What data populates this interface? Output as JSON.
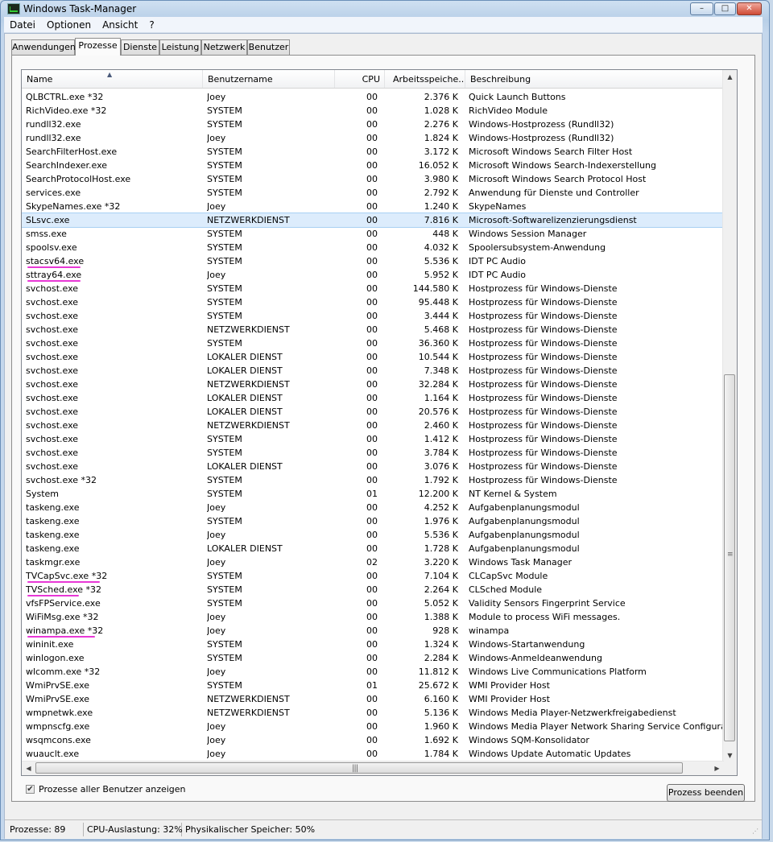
{
  "window": {
    "title": "Windows Task-Manager"
  },
  "menu": [
    "Datei",
    "Optionen",
    "Ansicht",
    "?"
  ],
  "tabs": [
    "Anwendungen",
    "Prozesse",
    "Dienste",
    "Leistung",
    "Netzwerk",
    "Benutzer"
  ],
  "active_tab": "Prozesse",
  "columns": [
    "Name",
    "Benutzername",
    "CPU",
    "Arbeitsspeiche...",
    "Beschreibung"
  ],
  "rows": [
    {
      "name": "QLBCTRL.exe *32",
      "user": "Joey",
      "cpu": "00",
      "mem": "2.376 K",
      "desc": "Quick Launch Buttons"
    },
    {
      "name": "RichVideo.exe *32",
      "user": "SYSTEM",
      "cpu": "00",
      "mem": "1.028 K",
      "desc": "RichVideo Module"
    },
    {
      "name": "rundll32.exe",
      "user": "SYSTEM",
      "cpu": "00",
      "mem": "2.276 K",
      "desc": "Windows-Hostprozess (Rundll32)"
    },
    {
      "name": "rundll32.exe",
      "user": "Joey",
      "cpu": "00",
      "mem": "1.824 K",
      "desc": "Windows-Hostprozess (Rundll32)"
    },
    {
      "name": "SearchFilterHost.exe",
      "user": "SYSTEM",
      "cpu": "00",
      "mem": "3.172 K",
      "desc": "Microsoft Windows Search Filter Host"
    },
    {
      "name": "SearchIndexer.exe",
      "user": "SYSTEM",
      "cpu": "00",
      "mem": "16.052 K",
      "desc": "Microsoft Windows Search-Indexerstellung"
    },
    {
      "name": "SearchProtocolHost.exe",
      "user": "SYSTEM",
      "cpu": "00",
      "mem": "3.980 K",
      "desc": "Microsoft Windows Search Protocol Host"
    },
    {
      "name": "services.exe",
      "user": "SYSTEM",
      "cpu": "00",
      "mem": "2.792 K",
      "desc": "Anwendung für Dienste und Controller"
    },
    {
      "name": "SkypeNames.exe *32",
      "user": "Joey",
      "cpu": "00",
      "mem": "1.240 K",
      "desc": "SkypeNames"
    },
    {
      "name": "SLsvc.exe",
      "user": "NETZWERKDIENST",
      "cpu": "00",
      "mem": "7.816 K",
      "desc": "Microsoft-Softwarelizenzierungsdienst",
      "selected": true
    },
    {
      "name": "smss.exe",
      "user": "SYSTEM",
      "cpu": "00",
      "mem": "448 K",
      "desc": "Windows Session Manager"
    },
    {
      "name": "spoolsv.exe",
      "user": "SYSTEM",
      "cpu": "00",
      "mem": "4.032 K",
      "desc": "Spoolersubsystem-Anwendung"
    },
    {
      "name": "stacsv64.exe",
      "user": "SYSTEM",
      "cpu": "00",
      "mem": "5.536 K",
      "desc": "IDT PC Audio",
      "underline": 66
    },
    {
      "name": "sttray64.exe",
      "user": "Joey",
      "cpu": "00",
      "mem": "5.952 K",
      "desc": "IDT PC Audio",
      "underline": 66
    },
    {
      "name": "svchost.exe",
      "user": "SYSTEM",
      "cpu": "00",
      "mem": "144.580 K",
      "desc": "Hostprozess für Windows-Dienste"
    },
    {
      "name": "svchost.exe",
      "user": "SYSTEM",
      "cpu": "00",
      "mem": "95.448 K",
      "desc": "Hostprozess für Windows-Dienste"
    },
    {
      "name": "svchost.exe",
      "user": "SYSTEM",
      "cpu": "00",
      "mem": "3.444 K",
      "desc": "Hostprozess für Windows-Dienste"
    },
    {
      "name": "svchost.exe",
      "user": "NETZWERKDIENST",
      "cpu": "00",
      "mem": "5.468 K",
      "desc": "Hostprozess für Windows-Dienste"
    },
    {
      "name": "svchost.exe",
      "user": "SYSTEM",
      "cpu": "00",
      "mem": "36.360 K",
      "desc": "Hostprozess für Windows-Dienste"
    },
    {
      "name": "svchost.exe",
      "user": "LOKALER DIENST",
      "cpu": "00",
      "mem": "10.544 K",
      "desc": "Hostprozess für Windows-Dienste"
    },
    {
      "name": "svchost.exe",
      "user": "LOKALER DIENST",
      "cpu": "00",
      "mem": "7.348 K",
      "desc": "Hostprozess für Windows-Dienste"
    },
    {
      "name": "svchost.exe",
      "user": "NETZWERKDIENST",
      "cpu": "00",
      "mem": "32.284 K",
      "desc": "Hostprozess für Windows-Dienste"
    },
    {
      "name": "svchost.exe",
      "user": "LOKALER DIENST",
      "cpu": "00",
      "mem": "1.164 K",
      "desc": "Hostprozess für Windows-Dienste"
    },
    {
      "name": "svchost.exe",
      "user": "LOKALER DIENST",
      "cpu": "00",
      "mem": "20.576 K",
      "desc": "Hostprozess für Windows-Dienste"
    },
    {
      "name": "svchost.exe",
      "user": "NETZWERKDIENST",
      "cpu": "00",
      "mem": "2.460 K",
      "desc": "Hostprozess für Windows-Dienste"
    },
    {
      "name": "svchost.exe",
      "user": "SYSTEM",
      "cpu": "00",
      "mem": "1.412 K",
      "desc": "Hostprozess für Windows-Dienste"
    },
    {
      "name": "svchost.exe",
      "user": "SYSTEM",
      "cpu": "00",
      "mem": "3.784 K",
      "desc": "Hostprozess für Windows-Dienste"
    },
    {
      "name": "svchost.exe",
      "user": "LOKALER DIENST",
      "cpu": "00",
      "mem": "3.076 K",
      "desc": "Hostprozess für Windows-Dienste"
    },
    {
      "name": "svchost.exe *32",
      "user": "SYSTEM",
      "cpu": "00",
      "mem": "1.792 K",
      "desc": "Hostprozess für Windows-Dienste"
    },
    {
      "name": "System",
      "user": "SYSTEM",
      "cpu": "01",
      "mem": "12.200 K",
      "desc": "NT Kernel & System"
    },
    {
      "name": "taskeng.exe",
      "user": "Joey",
      "cpu": "00",
      "mem": "4.252 K",
      "desc": "Aufgabenplanungsmodul"
    },
    {
      "name": "taskeng.exe",
      "user": "SYSTEM",
      "cpu": "00",
      "mem": "1.976 K",
      "desc": "Aufgabenplanungsmodul"
    },
    {
      "name": "taskeng.exe",
      "user": "Joey",
      "cpu": "00",
      "mem": "5.536 K",
      "desc": "Aufgabenplanungsmodul"
    },
    {
      "name": "taskeng.exe",
      "user": "LOKALER DIENST",
      "cpu": "00",
      "mem": "1.728 K",
      "desc": "Aufgabenplanungsmodul"
    },
    {
      "name": "taskmgr.exe",
      "user": "Joey",
      "cpu": "02",
      "mem": "3.220 K",
      "desc": "Windows Task Manager"
    },
    {
      "name": "TVCapSvc.exe *32",
      "user": "SYSTEM",
      "cpu": "00",
      "mem": "7.104 K",
      "desc": "CLCapSvc Module",
      "underline": 90
    },
    {
      "name": "TVSched.exe *32",
      "user": "SYSTEM",
      "cpu": "00",
      "mem": "2.264 K",
      "desc": "CLSched Module",
      "underline": 64
    },
    {
      "name": "vfsFPService.exe",
      "user": "SYSTEM",
      "cpu": "00",
      "mem": "5.052 K",
      "desc": "Validity Sensors Fingerprint Service"
    },
    {
      "name": "WiFiMsg.exe *32",
      "user": "Joey",
      "cpu": "00",
      "mem": "1.388 K",
      "desc": "Module to process WiFi messages."
    },
    {
      "name": "winampa.exe *32",
      "user": "Joey",
      "cpu": "00",
      "mem": "928 K",
      "desc": "winampa",
      "underline": 84
    },
    {
      "name": "wininit.exe",
      "user": "SYSTEM",
      "cpu": "00",
      "mem": "1.324 K",
      "desc": "Windows-Startanwendung"
    },
    {
      "name": "winlogon.exe",
      "user": "SYSTEM",
      "cpu": "00",
      "mem": "2.284 K",
      "desc": "Windows-Anmeldeanwendung"
    },
    {
      "name": "wlcomm.exe *32",
      "user": "Joey",
      "cpu": "00",
      "mem": "11.812 K",
      "desc": "Windows Live Communications Platform"
    },
    {
      "name": "WmiPrvSE.exe",
      "user": "SYSTEM",
      "cpu": "01",
      "mem": "25.672 K",
      "desc": "WMI Provider Host"
    },
    {
      "name": "WmiPrvSE.exe",
      "user": "NETZWERKDIENST",
      "cpu": "00",
      "mem": "6.160 K",
      "desc": "WMI Provider Host"
    },
    {
      "name": "wmpnetwk.exe",
      "user": "NETZWERKDIENST",
      "cpu": "00",
      "mem": "5.136 K",
      "desc": "Windows Media Player-Netzwerkfreigabedienst"
    },
    {
      "name": "wmpnscfg.exe",
      "user": "Joey",
      "cpu": "00",
      "mem": "1.960 K",
      "desc": "Windows Media Player Network Sharing Service Configuration Appl"
    },
    {
      "name": "wsqmcons.exe",
      "user": "Joey",
      "cpu": "00",
      "mem": "1.692 K",
      "desc": "Windows SQM-Konsolidator"
    },
    {
      "name": "wuauclt.exe",
      "user": "Joey",
      "cpu": "00",
      "mem": "1.784 K",
      "desc": "Windows Update Automatic Updates"
    }
  ],
  "show_all_users": {
    "label": "Prozesse aller Benutzer anzeigen",
    "checked": true
  },
  "end_process_label": "Prozess beenden",
  "status": {
    "processes": "Prozesse: 89",
    "cpu": "CPU-Auslastung: 32%",
    "memory": "Physikalischer Speicher: 50%"
  },
  "colors": {
    "selection": "#dcecfc",
    "annotation_underline": "#e838d6"
  }
}
